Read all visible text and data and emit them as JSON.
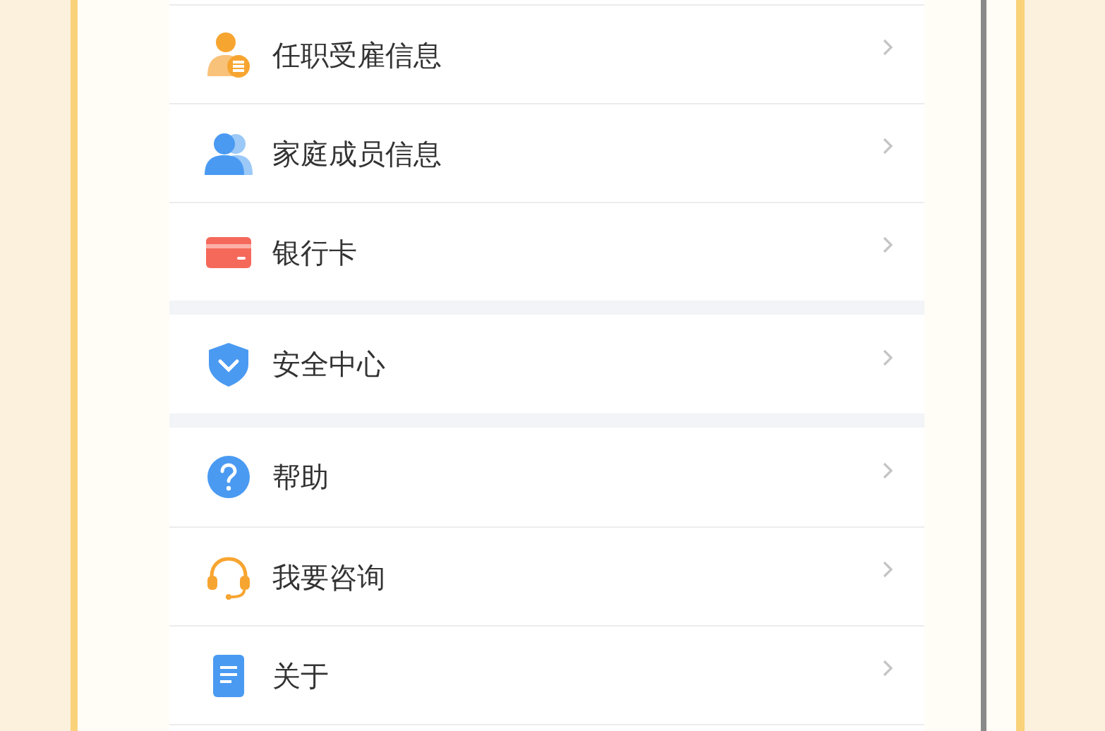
{
  "sections": [
    {
      "items": [
        {
          "label": "任职受雇信息",
          "kind": "employment"
        },
        {
          "label": "家庭成员信息",
          "kind": "family"
        },
        {
          "label": "银行卡",
          "kind": "card"
        }
      ]
    },
    {
      "items": [
        {
          "label": "安全中心",
          "kind": "shield"
        }
      ]
    },
    {
      "items": [
        {
          "label": "帮助",
          "kind": "help"
        },
        {
          "label": "我要咨询",
          "kind": "headset"
        },
        {
          "label": "关于",
          "kind": "doc"
        }
      ]
    }
  ]
}
